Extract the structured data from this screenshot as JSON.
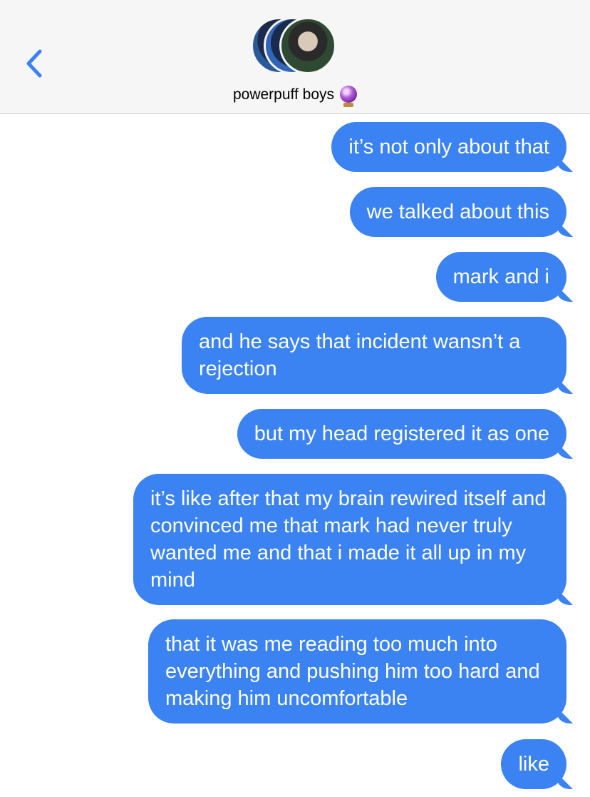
{
  "header": {
    "title": "powerpuff boys",
    "title_emoji": "crystal-ball-icon",
    "back_icon": "chevron-left-icon",
    "avatar_count": 3
  },
  "messages": [
    {
      "text": "it’s not only about that",
      "sender": "me"
    },
    {
      "text": "we talked about this",
      "sender": "me"
    },
    {
      "text": "mark and i",
      "sender": "me"
    },
    {
      "text": "and he says that incident wansn’t a rejection",
      "sender": "me"
    },
    {
      "text": "but my head registered it as one",
      "sender": "me"
    },
    {
      "text": "it’s like after that my brain rewired itself and convinced me that mark had never truly wanted me and that i made it all up in my mind",
      "sender": "me"
    },
    {
      "text": "that it was me reading too much into everything and pushing him too hard and making him uncomfortable",
      "sender": "me"
    },
    {
      "text": "like",
      "sender": "me"
    }
  ],
  "colors": {
    "bubble_blue": "#3b82f2",
    "header_bg": "#f6f6f6",
    "back_blue": "#3b82f2"
  }
}
